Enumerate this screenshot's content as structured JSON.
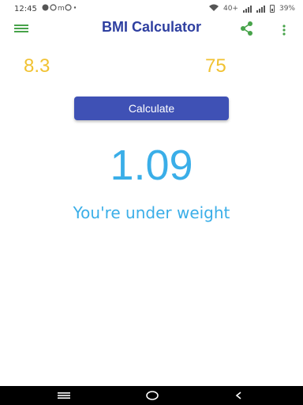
{
  "status_bar": {
    "time": "12:45",
    "network_label": "40+",
    "battery_label": "39%"
  },
  "app_bar": {
    "title": "BMI Calculator",
    "icons": [
      "menu-icon",
      "share-icon",
      "more-vert-icon"
    ]
  },
  "inputs": {
    "weight_value": "8.3",
    "height_value": "75"
  },
  "calculate_button": {
    "label": "Calculate"
  },
  "result": {
    "bmi_value": "1.09",
    "status_text": "You're under weight"
  },
  "nav_bar": {
    "icons": [
      "recents-icon",
      "home-icon",
      "back-icon"
    ]
  },
  "colors": {
    "title": "#2e3fa0",
    "accent_green": "#47a34a",
    "input_text": "#f1c232",
    "button": "#3f51b5",
    "result": "#3aaee8"
  }
}
